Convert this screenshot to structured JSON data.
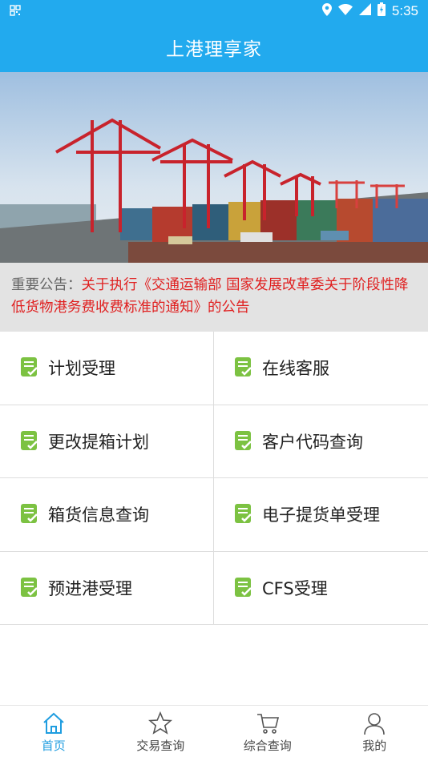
{
  "status": {
    "time": "5:35"
  },
  "app": {
    "title": "上港理享家"
  },
  "notice": {
    "label": "重要公告：",
    "text": "关于执行《交通运输部 国家发展改革委关于阶段性降低货物港务费收费标准的通知》的公告"
  },
  "menu": [
    {
      "label": "计划受理"
    },
    {
      "label": "在线客服"
    },
    {
      "label": "更改提箱计划"
    },
    {
      "label": "客户代码查询"
    },
    {
      "label": "箱货信息查询"
    },
    {
      "label": "电子提货单受理"
    },
    {
      "label": "预进港受理"
    },
    {
      "label": "CFS受理"
    }
  ],
  "tabs": [
    {
      "label": "首页",
      "icon": "home-icon",
      "active": true
    },
    {
      "label": "交易查询",
      "icon": "star-icon",
      "active": false
    },
    {
      "label": "综合查询",
      "icon": "cart-icon",
      "active": false
    },
    {
      "label": "我的",
      "icon": "user-icon",
      "active": false
    }
  ],
  "colors": {
    "primary": "#22aaee",
    "notice_red": "#e02020",
    "icon_green": "#7cc242"
  }
}
